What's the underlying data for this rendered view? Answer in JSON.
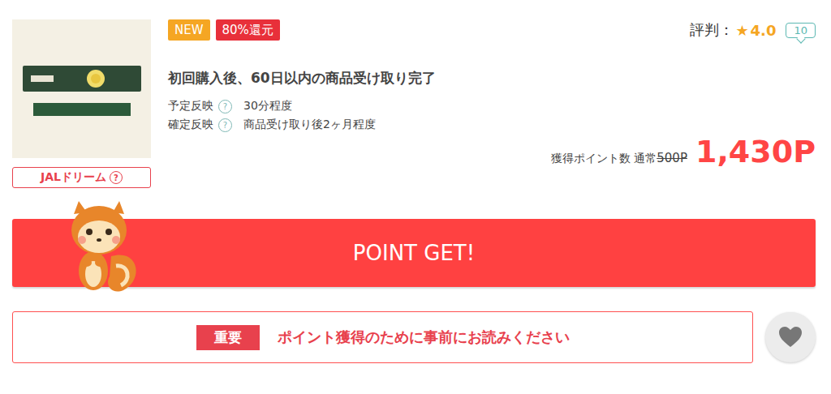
{
  "thumbnail": {
    "badge": "JALドリーム",
    "help": "?"
  },
  "badges": [
    {
      "label": "NEW",
      "color": "#f5a623"
    },
    {
      "label": "80%還元",
      "color": "#e8303a"
    }
  ],
  "rating": {
    "label": "評判：",
    "star": "★",
    "score": "4.0",
    "count": "10"
  },
  "title": "初回購入後、60日以内の商品受け取り完了",
  "schedule": [
    {
      "label": "予定反映",
      "help": "?",
      "value": "30分程度"
    },
    {
      "label": "確定反映",
      "help": "?",
      "value": "商品受け取り後2ヶ月程度"
    }
  ],
  "points": {
    "label": "獲得ポイント数 通常",
    "regular": "500P",
    "value": "1,430P"
  },
  "cta": {
    "label": "POINT GET!"
  },
  "notice": {
    "tag": "重要",
    "text": "ポイント獲得のために事前にお読みください"
  },
  "favorite": {
    "on": false
  }
}
